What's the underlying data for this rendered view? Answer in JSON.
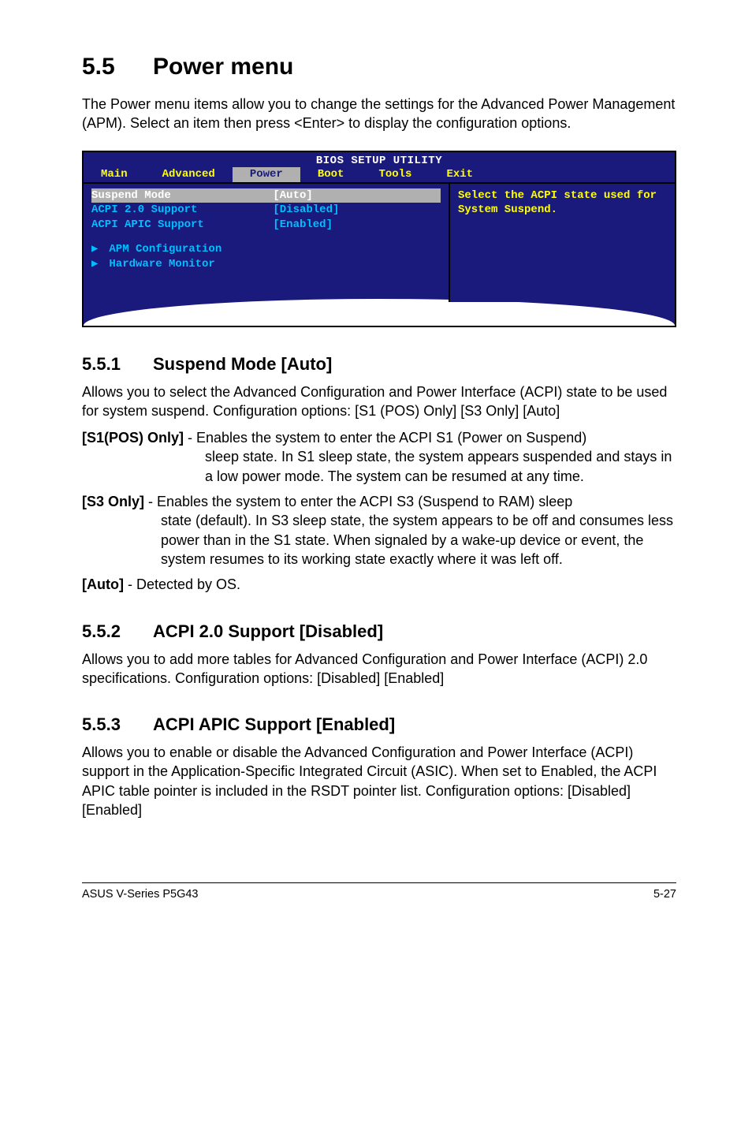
{
  "heading": {
    "num": "5.5",
    "title": "Power menu"
  },
  "intro": "The Power menu items allow you to change the settings for the Advanced Power Management (APM). Select an item then press <Enter> to display the configuration options.",
  "bios": {
    "title": "BIOS SETUP UTILITY",
    "tabs": [
      "Main",
      "Advanced",
      "Power",
      "Boot",
      "Tools",
      "Exit"
    ],
    "active_tab_index": 2,
    "rows": [
      {
        "label": "Suspend Mode",
        "value": "[Auto]",
        "selected": true
      },
      {
        "label": "ACPI 2.0 Support",
        "value": "[Disabled]",
        "selected": false
      },
      {
        "label": "ACPI APIC Support",
        "value": "[Enabled]",
        "selected": false
      }
    ],
    "submenus": [
      "APM Configuration",
      "Hardware Monitor"
    ],
    "help": "Select the ACPI state used for System Suspend."
  },
  "s551": {
    "num": "5.5.1",
    "title": "Suspend Mode [Auto]",
    "body": "Allows you to select the Advanced Configuration and Power Interface (ACPI) state to be used for system suspend. Configuration options: [S1 (POS) Only] [S3 Only] [Auto]",
    "opt_s1_label": "[S1(POS) Only]",
    "opt_s1_text_first": " - Enables the system to enter the ACPI S1 (Power on Suspend)",
    "opt_s1_text_cont": "sleep state. In S1 sleep state, the system appears suspended and stays in a low power mode. The system can be resumed at any time.",
    "opt_s3_label": "[S3 Only]",
    "opt_s3_text_first": " - Enables the system to enter the ACPI S3 (Suspend to RAM) sleep",
    "opt_s3_text_cont": "state (default). In S3 sleep state, the system appears to be off and consumes less power than in the S1 state. When signaled by a wake-up device or event, the system resumes to its working state exactly where it was left off.",
    "opt_auto_label": "[Auto]",
    "opt_auto_text": " - Detected by OS."
  },
  "s552": {
    "num": "5.5.2",
    "title": "ACPI 2.0 Support [Disabled]",
    "body": "Allows you to add more tables for Advanced Configuration and Power Interface (ACPI) 2.0 specifications. Configuration options: [Disabled] [Enabled]"
  },
  "s553": {
    "num": "5.5.3",
    "title": "ACPI APIC Support [Enabled]",
    "body": "Allows you to enable or disable the Advanced Configuration and Power Interface (ACPI) support in the Application-Specific Integrated Circuit (ASIC). When set to Enabled, the ACPI APIC table pointer is included in the RSDT pointer list. Configuration options: [Disabled] [Enabled]"
  },
  "footer": {
    "left": "ASUS V-Series P5G43",
    "right": "5-27"
  }
}
